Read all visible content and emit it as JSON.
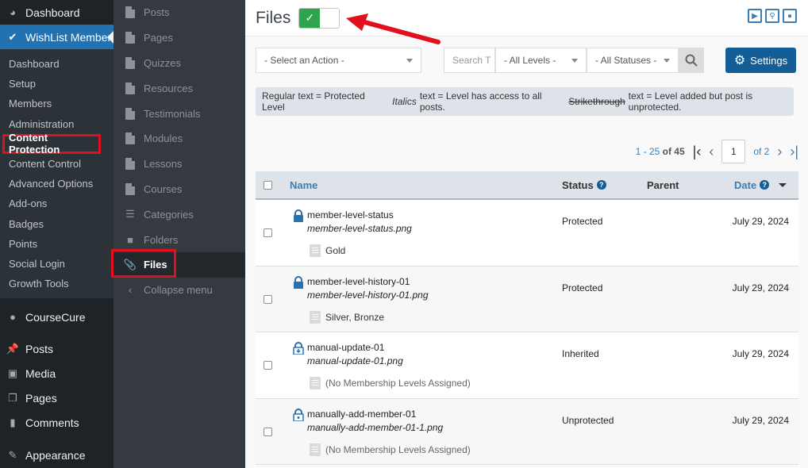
{
  "admin_menu": {
    "top": [
      {
        "label": "Dashboard",
        "icon": "dashboard-icon"
      },
      {
        "label": "WishList Member",
        "icon": "wishlist-icon"
      }
    ],
    "submenu": [
      "Dashboard",
      "Setup",
      "Members",
      "Administration",
      "Content Protection",
      "Content Control",
      "Advanced Options",
      "Add-ons",
      "Badges",
      "Points",
      "Social Login",
      "Growth Tools"
    ],
    "bottom": [
      {
        "label": "CourseCure",
        "icon": "coursecure-icon"
      },
      {
        "label": "Posts",
        "icon": "pin-icon"
      },
      {
        "label": "Media",
        "icon": "media-icon"
      },
      {
        "label": "Pages",
        "icon": "pages-icon"
      },
      {
        "label": "Comments",
        "icon": "comments-icon"
      },
      {
        "label": "Appearance",
        "icon": "appearance-icon"
      }
    ]
  },
  "subnav": {
    "items": [
      "Posts",
      "Pages",
      "Quizzes",
      "Resources",
      "Testimonials",
      "Modules",
      "Lessons",
      "Courses",
      "Categories",
      "Folders",
      "Files"
    ],
    "collapse": "Collapse menu"
  },
  "header": {
    "title": "Files",
    "toggle_check": "✓"
  },
  "toolbar": {
    "action_select": "- Select an Action -",
    "search_placeholder": "Search T",
    "levels_select": "- All Levels -",
    "statuses_select": "- All Statuses -",
    "settings_label": "Settings"
  },
  "legend": {
    "regular": "Regular text = Protected Level",
    "italics_word": "Italics",
    "italics_rest": "text = Level has access to all posts.",
    "strike_word": "Strikethrough",
    "strike_rest": "text = Level added but post is unprotected."
  },
  "pager": {
    "range": "1 - 25",
    "of_total": "of 45",
    "page": "1",
    "of_pages": "of 2"
  },
  "table": {
    "headers": {
      "name": "Name",
      "status": "Status",
      "parent": "Parent",
      "date": "Date"
    },
    "rows": [
      {
        "title": "member-level-status",
        "file": "member-level-status.png",
        "levels": "Gold",
        "status": "Protected",
        "date": "July 29, 2024"
      },
      {
        "title": "member-level-history-01",
        "file": "member-level-history-01.png",
        "levels": "Silver, Bronze",
        "status": "Protected",
        "date": "July 29, 2024"
      },
      {
        "title": "manual-update-01",
        "file": "manual-update-01.png",
        "levels": "(No Membership Levels Assigned)",
        "status": "Inherited",
        "date": "July 29, 2024"
      },
      {
        "title": "manually-add-member-01",
        "file": "manually-add-member-01-1.png",
        "levels": "(No Membership Levels Assigned)",
        "status": "Unprotected",
        "date": "July 29, 2024"
      }
    ]
  },
  "colors": {
    "admin_bg": "#1d2327",
    "accent": "#2271b1",
    "highlight_red": "#e0101d",
    "toggle_green": "#2ea44f"
  }
}
